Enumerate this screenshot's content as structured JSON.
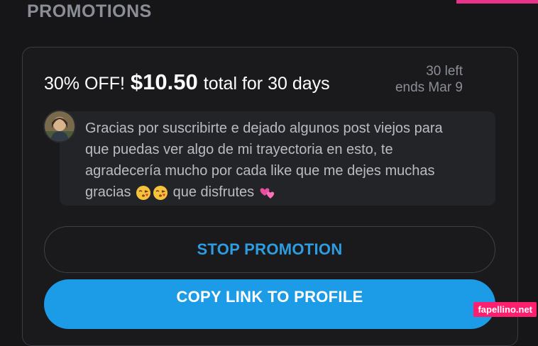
{
  "section": {
    "title": "PROMOTIONS"
  },
  "promotion": {
    "discount": "30% OFF!",
    "price": "$10.50",
    "duration": "total for 30 days",
    "remaining": "30 left",
    "ends": "ends Mar 9"
  },
  "message": {
    "line1": "Gracias por suscribirte e dejado algunos post viejos para",
    "line2": "que puedas ver algo de mi trayectoria en esto, te",
    "line3": "agradecería mucho por cada like que me dejes muchas",
    "line4_text": "gracias",
    "line4_end": "que disfrutes",
    "emojis": [
      "kissing-face-emoji",
      "kissing-face-emoji",
      "two-hearts-emoji"
    ]
  },
  "buttons": {
    "stop": "STOP PROMOTION",
    "copy": "COPY LINK TO PROFILE"
  },
  "watermark": "fapellino.net",
  "colors": {
    "background": "#161619",
    "accent_blue": "#1c9be6",
    "link_blue": "#2d9ce0",
    "muted_gray": "#8b8e96",
    "watermark_pink": "#ff1f6f"
  }
}
